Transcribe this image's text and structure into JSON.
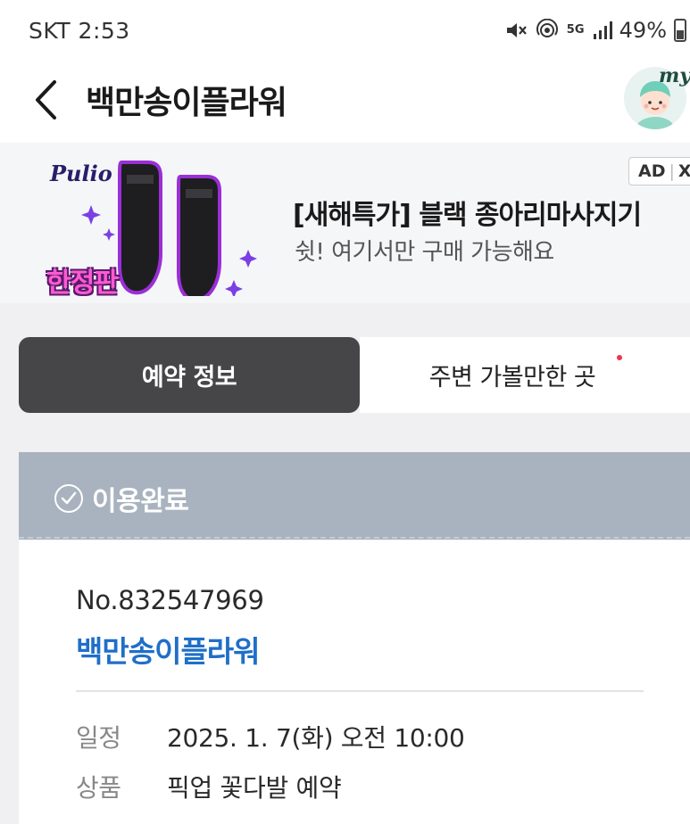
{
  "status_bar": {
    "carrier_time": "SKT 2:53",
    "five_g": "5G",
    "battery": "49%"
  },
  "header": {
    "title": "백만송이플라워",
    "avatar_text": "my"
  },
  "ad": {
    "brand": "Pulio",
    "badge": "한정판",
    "tag": "AD",
    "tag_close": "X",
    "title": "[새해특가] 블랙 종아리마사지기",
    "subtitle": "쉿! 여기서만 구매 가능해요"
  },
  "tabs": {
    "active": "예약 정보",
    "inactive": "주변 가볼만한 곳"
  },
  "status": {
    "label": "이용완료"
  },
  "reservation": {
    "number": "No.832547969",
    "store": "백만송이플라워",
    "rows": [
      {
        "label": "일정",
        "value": "2025. 1. 7(화) 오전 10:00"
      },
      {
        "label": "상품",
        "value": "픽업 꽃다발 예약"
      }
    ]
  },
  "colors": {
    "accent_blue": "#1f6fc8",
    "tab_active_bg": "#464649",
    "status_card_bg": "#a9b3bf",
    "notification_dot": "#f0344a"
  }
}
